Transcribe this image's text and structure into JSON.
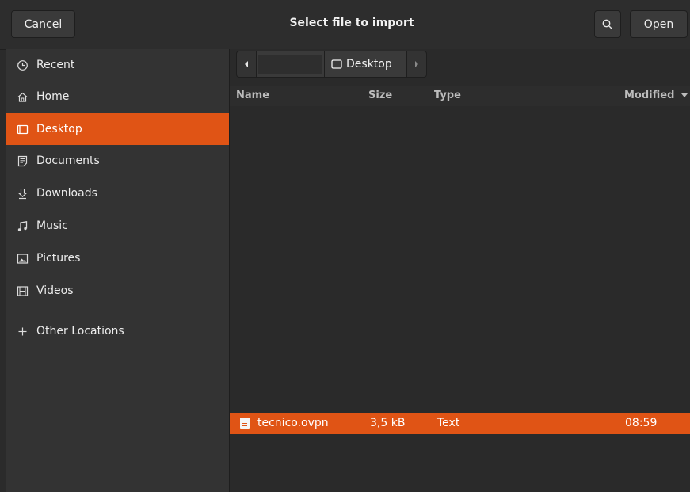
{
  "header": {
    "cancel_label": "Cancel",
    "title": "Select file to import",
    "open_label": "Open"
  },
  "sidebar": {
    "items": [
      {
        "label": "Recent",
        "icon": "clock-icon"
      },
      {
        "label": "Home",
        "icon": "home-icon"
      },
      {
        "label": "Desktop",
        "icon": "desktop-icon",
        "active": true
      },
      {
        "label": "Documents",
        "icon": "document-icon"
      },
      {
        "label": "Downloads",
        "icon": "download-icon"
      },
      {
        "label": "Music",
        "icon": "music-icon"
      },
      {
        "label": "Pictures",
        "icon": "picture-icon"
      },
      {
        "label": "Videos",
        "icon": "video-icon"
      }
    ],
    "other_locations": "Other Locations"
  },
  "pathbar": {
    "current": "Desktop"
  },
  "columns": {
    "name": "Name",
    "size": "Size",
    "type": "Type",
    "modified": "Modified"
  },
  "files": [
    {
      "name": "tecnico.ovpn",
      "size": "3,5 kB",
      "type": "Text",
      "modified": "08:59",
      "selected": true
    }
  ],
  "colors": {
    "accent": "#e05415",
    "background": "#2b2b2b"
  }
}
